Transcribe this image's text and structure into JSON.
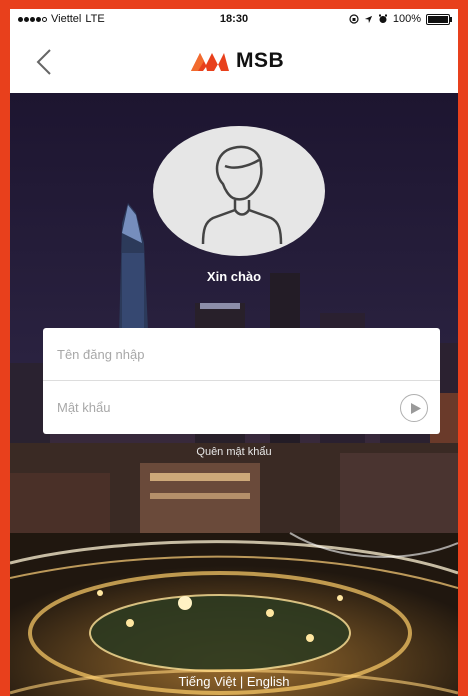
{
  "status_bar": {
    "carrier": "Viettel",
    "network": "LTE",
    "time": "18:30",
    "battery": "100%"
  },
  "nav": {
    "back_icon": "chevron-left-icon",
    "logo_text": "MSB",
    "logo_color": "#e8401c"
  },
  "profile": {
    "avatar_icon": "user-silhouette-icon",
    "greeting": "Xin chào"
  },
  "login": {
    "username_placeholder": "Tên đăng nhập",
    "password_placeholder": "Mật khẩu",
    "submit_icon": "play-arrow-icon",
    "forgot_password": "Quên mật khẩu"
  },
  "language": {
    "vietnamese": "Tiếng Việt",
    "separator": " | ",
    "english": "English"
  },
  "colors": {
    "brand": "#e8401c",
    "border": "#e8401c"
  }
}
